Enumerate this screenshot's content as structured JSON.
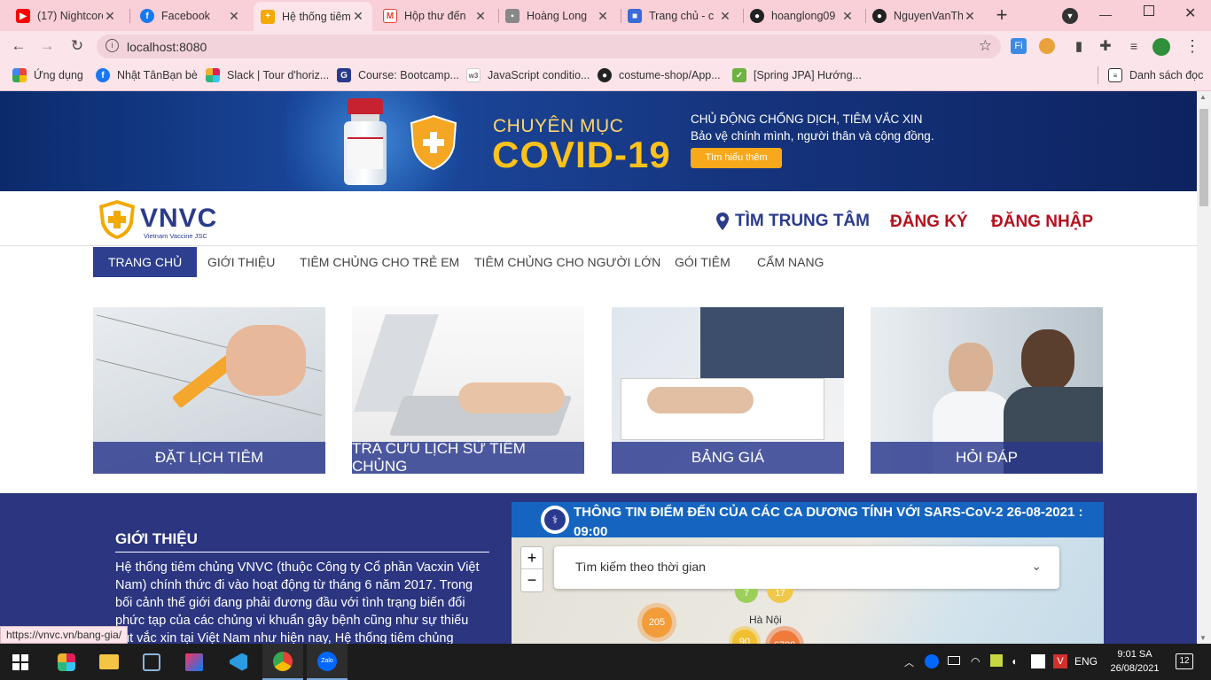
{
  "browser": {
    "tabs": [
      {
        "title": "(17) Nightcore",
        "icon": "youtube-icon",
        "color": "#ff0000"
      },
      {
        "title": "Facebook",
        "icon": "facebook-icon",
        "color": "#1877f2"
      },
      {
        "title": "Hệ thống tiêm",
        "icon": "vnvc-icon",
        "color": "#f2a900",
        "active": true
      },
      {
        "title": "Hộp thư đến",
        "icon": "gmail-icon",
        "color": "#ea4335"
      },
      {
        "title": "Hoàng Long",
        "icon": "page-icon",
        "color": "#888888"
      },
      {
        "title": "Trang chủ - c",
        "icon": "site-icon",
        "color": "#3b6bd6"
      },
      {
        "title": "hoanglong09",
        "icon": "github-icon",
        "color": "#222222"
      },
      {
        "title": "NguyenVanTh",
        "icon": "github-icon",
        "color": "#222222"
      }
    ],
    "new_tab": "+",
    "url": "localhost:8080",
    "bookmarks": [
      {
        "label": "Ứng dụng",
        "icon": "apps-grid-icon",
        "color": "#e8453c"
      },
      {
        "label": "Nhật TânBạn bè",
        "icon": "facebook-icon",
        "color": "#1877f2"
      },
      {
        "label": "Slack | Tour d'horiz...",
        "icon": "slack-icon",
        "color": "#4a154b"
      },
      {
        "label": "Course: Bootcamp...",
        "icon": "course-icon",
        "color": "#2a3a8c"
      },
      {
        "label": "JavaScript conditio...",
        "icon": "w3-icon",
        "color": "#999999"
      },
      {
        "label": "costume-shop/App...",
        "icon": "github-icon",
        "color": "#222222"
      },
      {
        "label": "[Spring JPA] Hướng...",
        "icon": "leaf-icon",
        "color": "#6db33f"
      }
    ],
    "reading_list": "Danh sách đọc"
  },
  "banner": {
    "title_small": "CHUYÊN MỤC",
    "title_big": "COVID-19",
    "line1": "CHỦ ĐỘNG CHỐNG DỊCH, TIÊM VẮC XIN",
    "line2": "Bảo vệ chính mình, người thân và cộng đồng.",
    "cta": "Tìm hiểu thêm"
  },
  "header": {
    "logo_text": "VNVC",
    "logo_sub": "Vietnam Vaccine JSC",
    "find_center": "TÌM TRUNG TÂM",
    "register": "ĐĂNG KÝ",
    "login": "ĐĂNG NHẬP"
  },
  "nav": [
    {
      "label": "TRANG CHỦ",
      "active": true
    },
    {
      "label": "GIỚI THIỆU"
    },
    {
      "label": "TIÊM CHỦNG CHO TRẺ EM"
    },
    {
      "label": "TIÊM CHỦNG CHO NGƯỜI LỚN"
    },
    {
      "label": "GÓI TIÊM"
    },
    {
      "label": "CẨM NANG"
    }
  ],
  "cards": [
    {
      "label": "ĐẶT LỊCH TIÊM"
    },
    {
      "label": "TRA CỨU LỊCH SỬ TIÊM CHỦNG"
    },
    {
      "label": "BẢNG GIÁ"
    },
    {
      "label": "HỎI ĐÁP"
    }
  ],
  "intro": {
    "heading": "GIỚI THIỆU",
    "text": "Hệ thống tiêm chủng VNVC (thuộc Công ty Cổ phần Vacxin Việt Nam) chính thức đi vào hoạt động từ tháng 6 năm 2017. Trong bối cảnh thế giới đang phải đương đầu với tình trạng biến đổi phức tạp của các chủng vi khuẩn gây bệnh cũng như sự thiếu hụt vắc xin tại Việt Nam như hiện nay, Hệ thống tiêm chủng"
  },
  "map": {
    "title": "THÔNG TIN ĐIỂM ĐẾN CỦA CÁC CA DƯƠNG TÍNH VỚI SARS-CoV-2 26-08-2021 : 09:00",
    "search_placeholder": "Tìm kiếm theo thời gian",
    "zoom_in": "+",
    "zoom_out": "−",
    "city": "Hà Nội",
    "clusters": [
      {
        "count": "205"
      },
      {
        "count": "90"
      },
      {
        "count": "6788"
      },
      {
        "count": "7"
      },
      {
        "count": "17"
      }
    ]
  },
  "status_url": "https://vnvc.vn/bang-gia/",
  "taskbar": {
    "lang": "ENG",
    "time": "9:01 SA",
    "date": "26/08/2021",
    "notif": "12"
  }
}
